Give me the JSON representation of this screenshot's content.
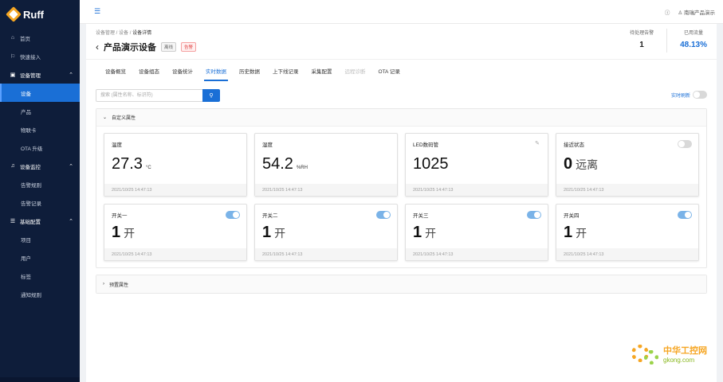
{
  "app": {
    "logo": "Ruff"
  },
  "sidebar": {
    "items": [
      {
        "label": "首页",
        "icon": "home-icon",
        "type": "top"
      },
      {
        "label": "快速接入",
        "icon": "quick-icon",
        "type": "top"
      },
      {
        "label": "设备管理",
        "icon": "device-mgmt-icon",
        "type": "group"
      },
      {
        "label": "设备",
        "type": "sub",
        "active": true
      },
      {
        "label": "产品",
        "type": "sub"
      },
      {
        "label": "物联卡",
        "type": "sub"
      },
      {
        "label": "OTA 升级",
        "type": "sub"
      },
      {
        "label": "设备监控",
        "icon": "bell-icon",
        "type": "group"
      },
      {
        "label": "告警规则",
        "type": "sub"
      },
      {
        "label": "告警记录",
        "type": "sub"
      },
      {
        "label": "基础配置",
        "icon": "list-icon",
        "type": "group"
      },
      {
        "label": "项目",
        "type": "sub"
      },
      {
        "label": "用户",
        "type": "sub"
      },
      {
        "label": "标签",
        "type": "sub"
      },
      {
        "label": "通知规则",
        "type": "sub"
      }
    ]
  },
  "topbar": {
    "user": "南瑞产品演示"
  },
  "header": {
    "breadcrumb": [
      "设备管理",
      "设备",
      "设备详情"
    ],
    "title": "产品演示设备",
    "badge_offline": "离线",
    "badge_alarm": "告警",
    "stats": [
      {
        "label": "待处理告警",
        "value": "1"
      },
      {
        "label": "已用流量",
        "value": "48.13%"
      }
    ]
  },
  "tabs": [
    "设备概览",
    "设备组态",
    "设备统计",
    "实时数据",
    "历史数据",
    "上下线记录",
    "采集配置",
    "远程诊断",
    "OTA 记录"
  ],
  "main": {
    "search_placeholder": "搜索 (属性名称、标识符)",
    "realtime_label": "实时刷新",
    "section_custom": "自定义属性",
    "section_preset": "预置属性",
    "cards_row1": [
      {
        "name": "温度",
        "value": "27.3",
        "unit": "°C",
        "time": "2021/10/25 14:47:13"
      },
      {
        "name": "湿度",
        "value": "54.2",
        "unit": "%RH",
        "time": "2021/10/25 14:47:13"
      },
      {
        "name": "LED数码管",
        "value": "1025",
        "unit": "",
        "time": "2021/10/25 14:47:13"
      },
      {
        "name": "接近状态",
        "value": "0",
        "unit": "远离",
        "time": "2021/10/25 14:47:13"
      }
    ],
    "cards_row2": [
      {
        "name": "开关一",
        "value": "1",
        "unit": "开",
        "time": "2021/10/25 14:47:13"
      },
      {
        "name": "开关二",
        "value": "1",
        "unit": "开",
        "time": "2021/10/25 14:47:13"
      },
      {
        "name": "开关三",
        "value": "1",
        "unit": "开",
        "time": "2021/10/25 14:47:13"
      },
      {
        "name": "开关四",
        "value": "1",
        "unit": "开",
        "time": "2021/10/25 14:47:13"
      }
    ]
  },
  "watermark": {
    "cn": "中华工控网",
    "url": "gkong.com"
  },
  "colors": {
    "primary": "#1a6fd6",
    "sidebar": "#0e1d3a",
    "alarm": "#e04646"
  }
}
